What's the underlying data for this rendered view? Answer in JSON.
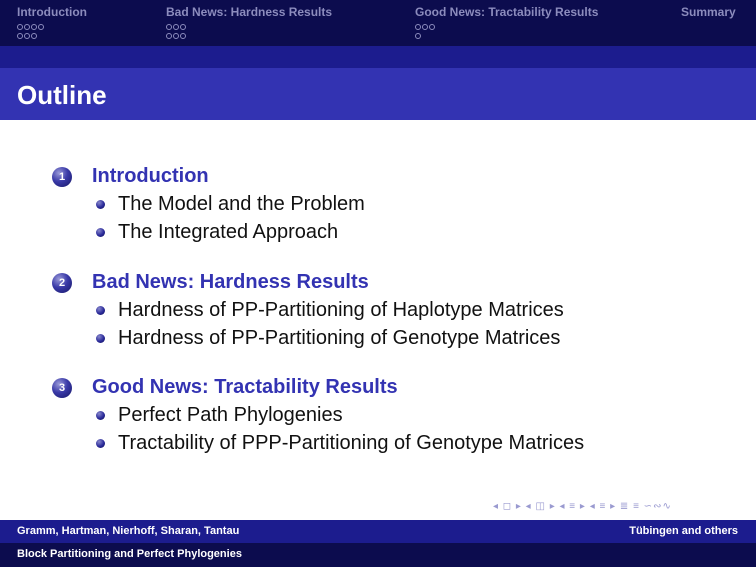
{
  "nav": {
    "sections": [
      {
        "label": "Introduction",
        "dot_rows": [
          4,
          3
        ]
      },
      {
        "label": "Bad News: Hardness Results",
        "dot_rows": [
          3,
          3
        ]
      },
      {
        "label": "Good News: Tractability Results",
        "dot_rows": [
          3,
          1
        ]
      },
      {
        "label": "Summary",
        "dot_rows": []
      }
    ]
  },
  "slide": {
    "title": "Outline"
  },
  "outline": [
    {
      "number": "1",
      "title": "Introduction",
      "items": [
        "The Model and the Problem",
        "The Integrated Approach"
      ]
    },
    {
      "number": "2",
      "title": "Bad News: Hardness Results",
      "items": [
        "Hardness of PP-Partitioning of Haplotype Matrices",
        "Hardness of PP-Partitioning of Genotype Matrices"
      ]
    },
    {
      "number": "3",
      "title": "Good News: Tractability Results",
      "items": [
        "Perfect Path Phylogenies",
        "Tractability of PPP-Partitioning of Genotype Matrices"
      ]
    }
  ],
  "nav_symbols": "◂ ◻ ▸ ◂ ◫ ▸ ◂ ≡ ▸ ◂ ≡ ▸ ≣ ≡ ∽∾∿",
  "footer": {
    "authors": "Gramm, Hartman, Nierhoff, Sharan, Tantau",
    "affiliation": "Tübingen and others",
    "talk_title": "Block Partitioning and Perfect Phylogenies"
  },
  "colors": {
    "nav_bg": "#0c0c4e",
    "title_bg": "#3333b2",
    "band_bg": "#1c1c8e",
    "section_title": "#3333b2",
    "nav_text": "#8c8cbd"
  }
}
